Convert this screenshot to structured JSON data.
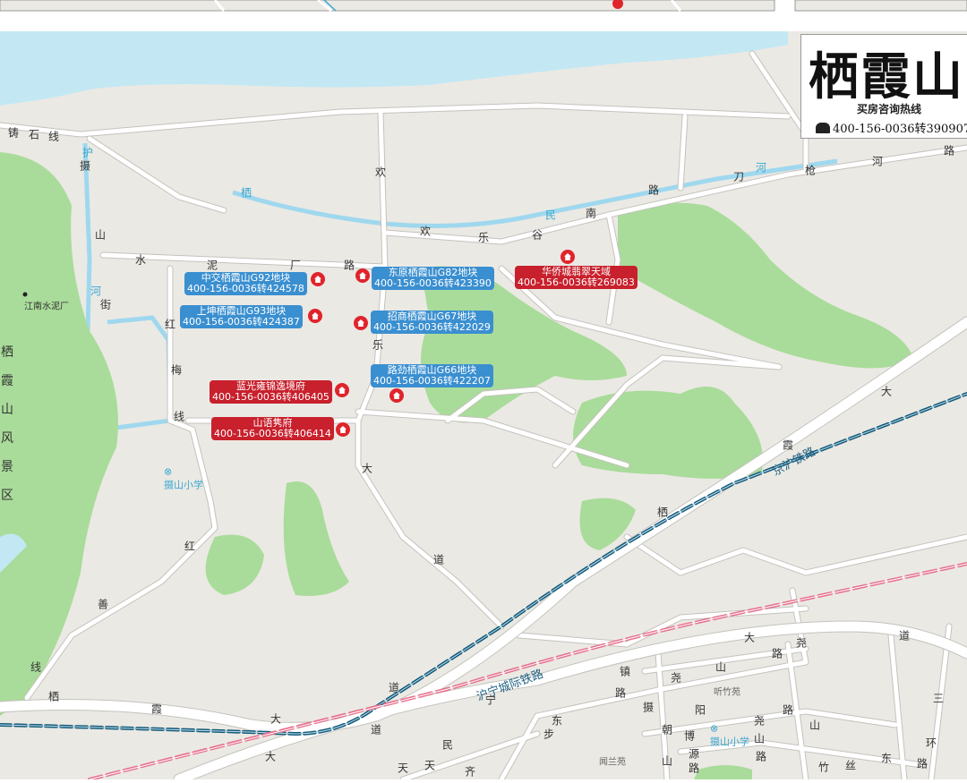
{
  "header": {
    "title": "栖霞山",
    "hotline_label": "买房咨询热线",
    "hotline": "400-156-0036转390907"
  },
  "colors": {
    "land": "#ebe9e4",
    "water": "#c3e8f4",
    "green": "#a9dc9a",
    "blue_card": "#3a8fd0",
    "red_card": "#c8202c",
    "rail_blue": "#145a7a",
    "rail_pink": "#e6708c"
  },
  "listings": [
    {
      "name": "中交栖霞山G92地块",
      "phone": "400-156-0036转424578",
      "type": "blue"
    },
    {
      "name": "东原栖霞山G82地块",
      "phone": "400-156-0036转423390",
      "type": "blue"
    },
    {
      "name": "华侨城翡翠天域",
      "phone": "400-156-0036转269083",
      "type": "red"
    },
    {
      "name": "上坤栖霞山G93地块",
      "phone": "400-156-0036转424387",
      "type": "blue"
    },
    {
      "name": "招商栖霞山G67地块",
      "phone": "400-156-0036转422029",
      "type": "blue"
    },
    {
      "name": "路劲栖霞山G66地块",
      "phone": "400-156-0036转422207",
      "type": "blue"
    },
    {
      "name": "蓝光雍锦逸境府",
      "phone": "400-156-0036转406405",
      "type": "red"
    },
    {
      "name": "山语隽府",
      "phone": "400-156-0036转406414",
      "type": "red"
    }
  ],
  "railways": [
    "京沪铁路",
    "沪宁城际铁路"
  ],
  "scenic_area": "栖霞山风景区",
  "places": [
    "江南水泥厂",
    "摄山小学",
    "摄山小学",
    "听竹苑",
    "闻兰苑"
  ],
  "road_chars": [
    "铸",
    "石",
    "线",
    "摄",
    "山",
    "街",
    "水",
    "泥",
    "厂",
    "路",
    "欢",
    "乐",
    "谷",
    "南",
    "路",
    "刀",
    "枪",
    "河",
    "路",
    "欢",
    "乐",
    "大",
    "道",
    "红",
    "梅",
    "线",
    "红",
    "善",
    "线",
    "栖",
    "霞",
    "大",
    "道",
    "大",
    "霞",
    "栖",
    "宁",
    "镇",
    "大",
    "道",
    "尧",
    "大",
    "道",
    "东",
    "民",
    "路",
    "步",
    "天",
    "齐",
    "天",
    "山",
    "摄",
    "尧",
    "山",
    "路",
    "阳",
    "路",
    "朝",
    "博",
    "源",
    "路",
    "尧",
    "山",
    "路",
    "竹",
    "丝",
    "东",
    "路",
    "三",
    "环",
    "山"
  ],
  "water_chars": [
    "护",
    "河",
    "栖",
    "民",
    "河"
  ]
}
